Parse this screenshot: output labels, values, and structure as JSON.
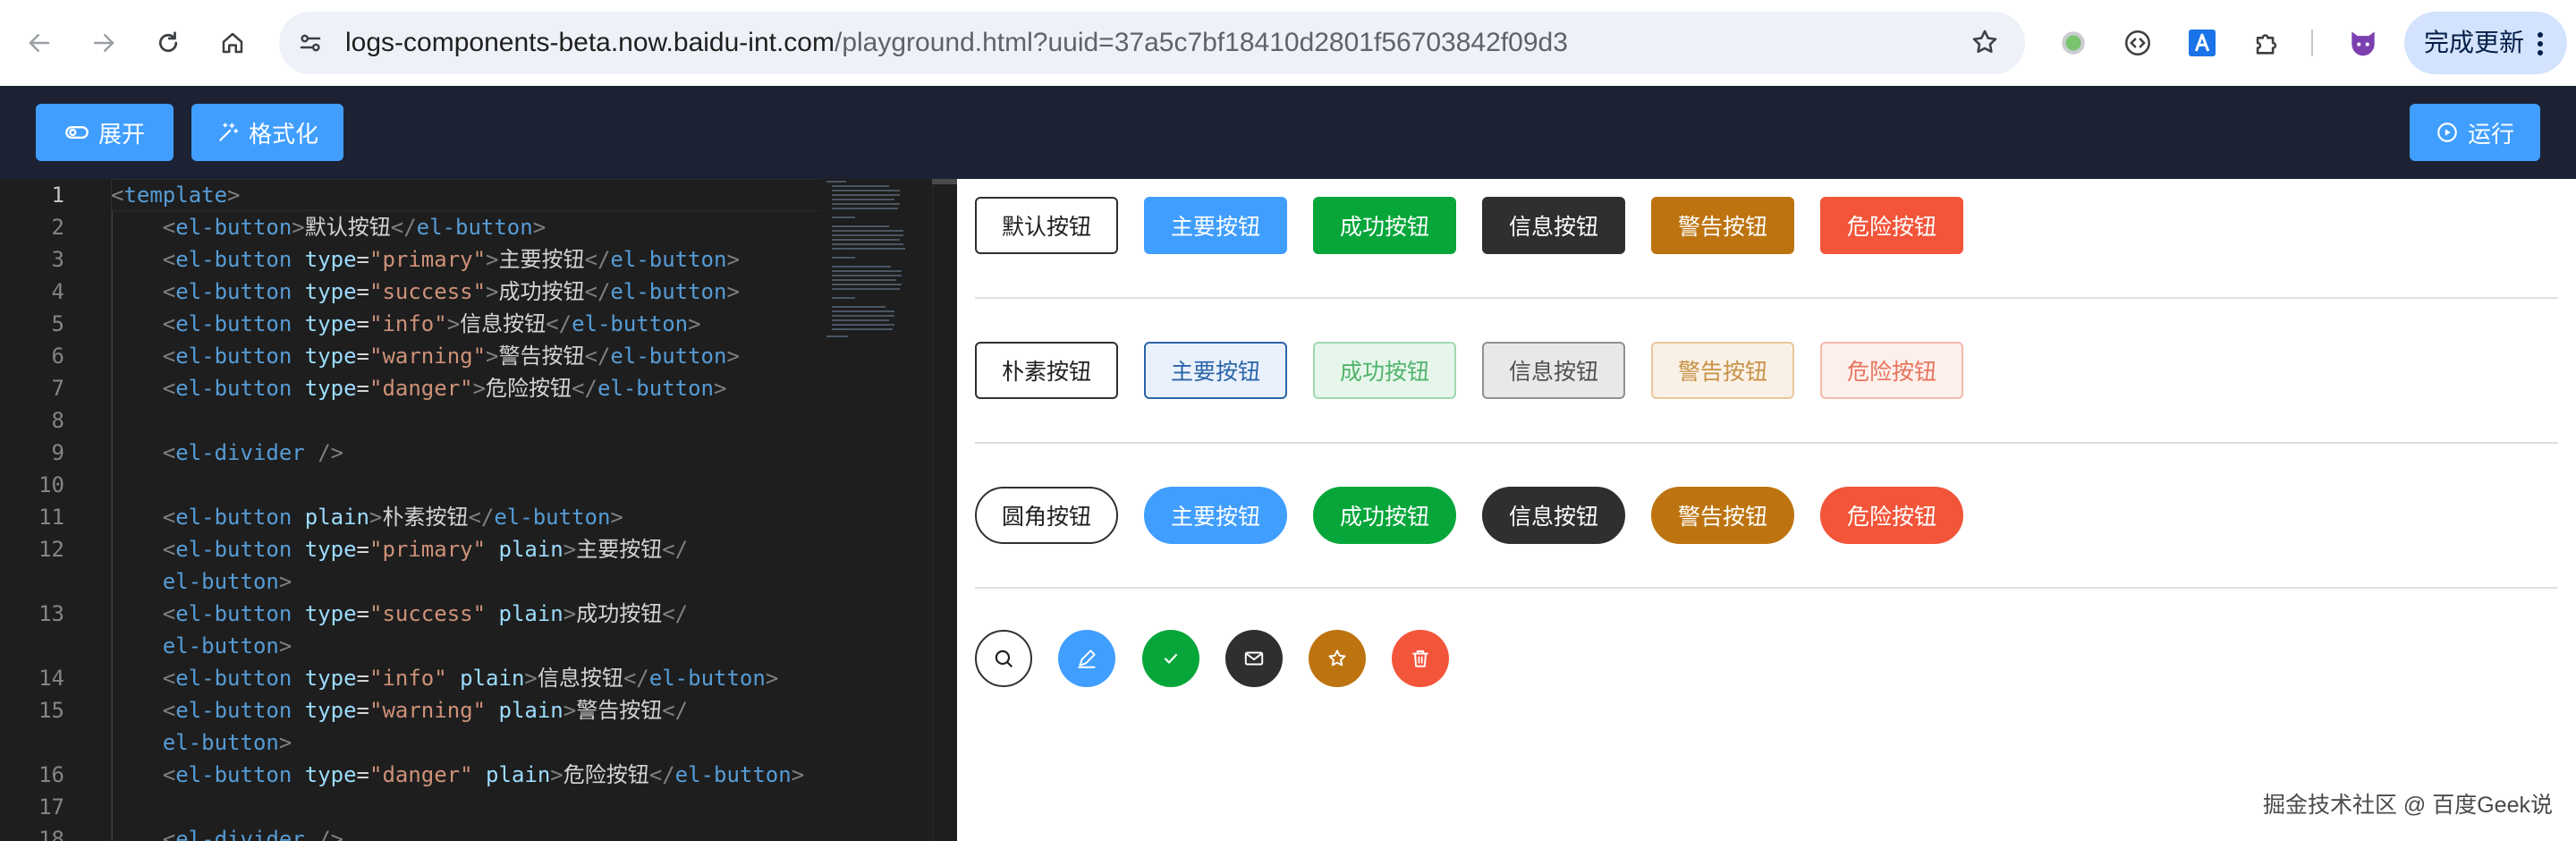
{
  "browser": {
    "url_host": "logs-components-beta.now.baidu-int.com",
    "url_path": "/playground.html?uuid=37a5c7bf18410d2801f56703842f09d3",
    "update_label": "完成更新",
    "icons": [
      "back-icon",
      "forward-icon",
      "reload-icon",
      "home-icon",
      "site-info-icon",
      "bookmark-star-icon",
      "extension-dot-icon",
      "extension-code-icon",
      "translate-icon",
      "extensions-puzzle-icon",
      "github-cat-icon",
      "more-vert-icon"
    ]
  },
  "toolbar": {
    "expand_label": "展开",
    "format_label": "格式化",
    "run_label": "运行"
  },
  "editor": {
    "line_numbers": [
      "1",
      "2",
      "3",
      "4",
      "5",
      "6",
      "7",
      "",
      "8",
      "9",
      "10",
      "11",
      "12",
      "",
      "13",
      "",
      "14",
      "15",
      "",
      "16",
      "17",
      "18"
    ],
    "colors": {
      "tag": "#569cd6",
      "attr": "#9cdcfe",
      "string": "#ce9178",
      "text": "#d4d4d4"
    }
  },
  "preview": {
    "row1": [
      "默认按钮",
      "主要按钮",
      "成功按钮",
      "信息按钮",
      "警告按钮",
      "危险按钮"
    ],
    "row2": [
      "朴素按钮",
      "主要按钮",
      "成功按钮",
      "信息按钮",
      "警告按钮",
      "危险按钮"
    ],
    "row3": [
      "圆角按钮",
      "主要按钮",
      "成功按钮",
      "信息按钮",
      "警告按钮",
      "危险按钮"
    ],
    "circle_icons": [
      "search-icon",
      "edit-icon",
      "check-icon",
      "message-icon",
      "star-icon",
      "delete-icon"
    ],
    "colors": {
      "primary": "#409eff",
      "success": "#07a63a",
      "info": "#2f2f2f",
      "warning": "#bd7410",
      "danger": "#f2553a"
    }
  },
  "watermark": "掘金技术社区 @ 百度Geek说"
}
